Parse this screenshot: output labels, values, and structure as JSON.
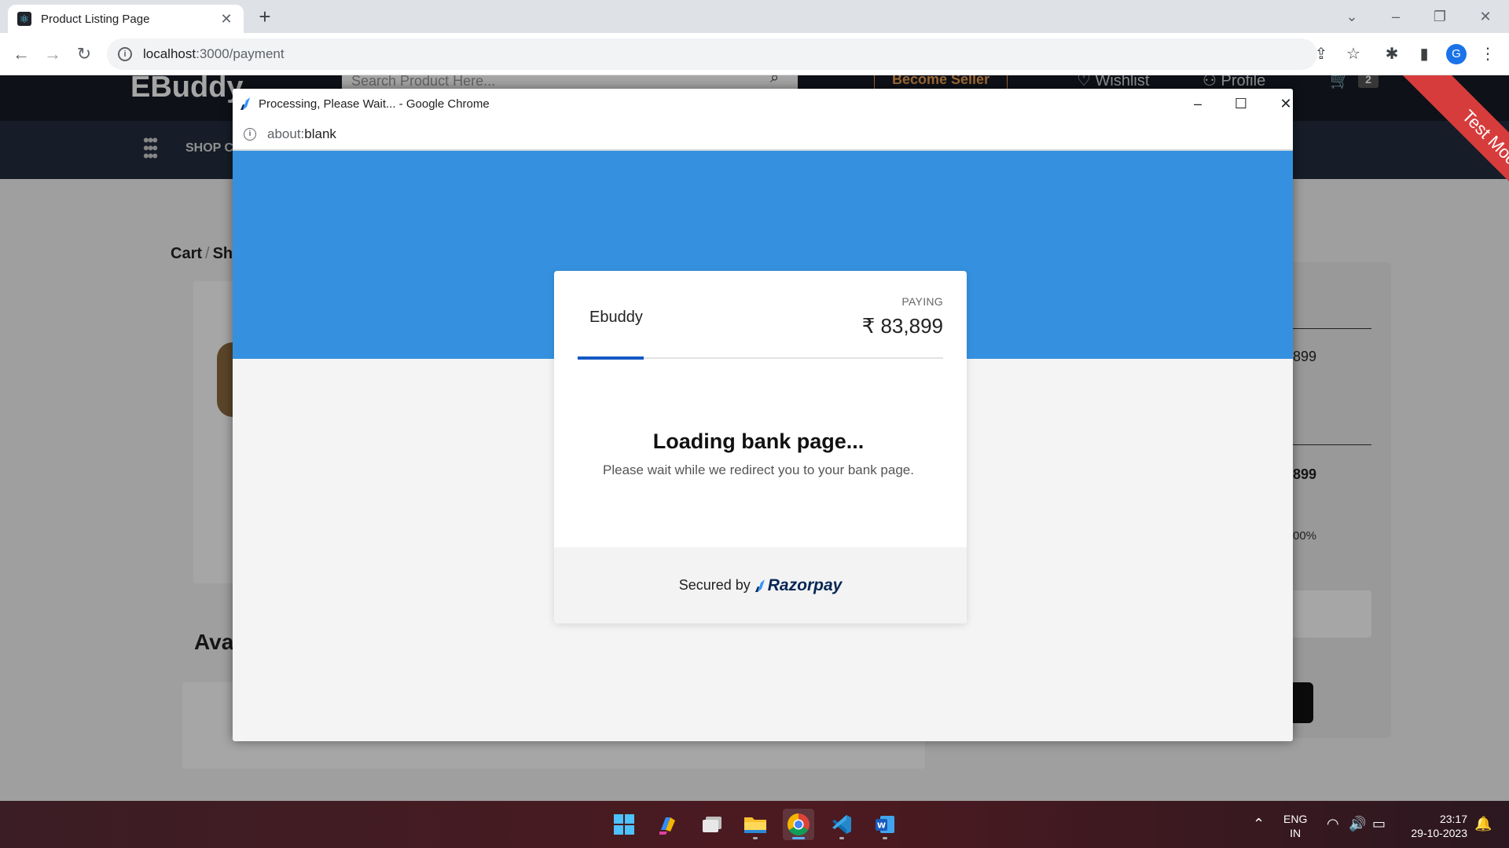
{
  "browser": {
    "tab_title": "Product Listing Page",
    "url_host": "localhost",
    "url_rest": ":3000/payment",
    "avatar_initial": "G"
  },
  "site": {
    "logo": "EBuddy",
    "search_placeholder": "Search Product Here...",
    "become_seller": "Become Seller",
    "wishlist": "Wishlist",
    "profile": "Profile",
    "cart_count": "2",
    "shop_label": "SHOP C",
    "breadcrumb_cart": "Cart",
    "breadcrumb_next": "Sh",
    "available_title": "Ava",
    "summary_val_1": "899",
    "summary_val_2": "899",
    "summary_pct": "00%",
    "test_mode": "Test Mode"
  },
  "popup": {
    "window_title": "Processing, Please Wait... - Google Chrome",
    "url_scheme": "about:",
    "url_path": "blank"
  },
  "payment": {
    "merchant": "Ebuddy",
    "paying_label": "PAYING",
    "amount": "₹ 83,899",
    "progress": 0.18,
    "loading_title": "Loading bank page...",
    "loading_subtitle": "Please wait while we redirect you to your bank page.",
    "secured_by": "Secured by",
    "brand": "Razorpay",
    "brand_color": "#072654",
    "header_color": "#3591df"
  },
  "taskbar": {
    "apps": [
      "start-icon",
      "copilot-icon",
      "task-view-icon",
      "file-explorer-icon",
      "chrome-icon",
      "vscode-icon",
      "word-icon"
    ],
    "lang_line1": "ENG",
    "lang_line2": "IN",
    "time": "23:17",
    "date": "29-10-2023"
  }
}
